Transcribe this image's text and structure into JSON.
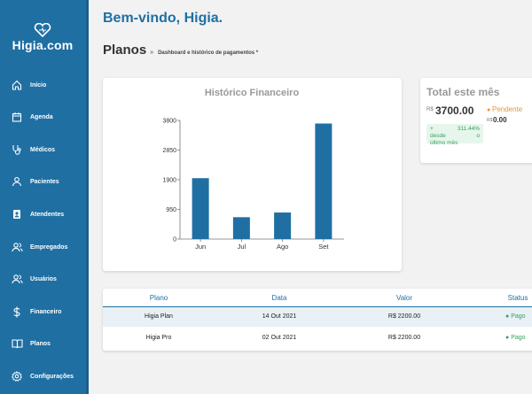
{
  "app": {
    "name": "Higia.com"
  },
  "sidebar": {
    "items": [
      {
        "label": "Início",
        "icon": "home-icon"
      },
      {
        "label": "Agenda",
        "icon": "calendar-icon"
      },
      {
        "label": "Médicos",
        "icon": "stethoscope-icon"
      },
      {
        "label": "Pacientes",
        "icon": "user-icon"
      },
      {
        "label": "Atendentes",
        "icon": "id-badge-icon"
      },
      {
        "label": "Empregados",
        "icon": "users-icon"
      },
      {
        "label": "Usuários",
        "icon": "users-icon"
      },
      {
        "label": "Financeiro",
        "icon": "dollar-icon"
      },
      {
        "label": "Planos",
        "icon": "book-icon"
      },
      {
        "label": "Configurações",
        "icon": "gear-icon"
      }
    ]
  },
  "header": {
    "welcome": "Bem-vindo, Higia.",
    "title": "Planos",
    "separator": "»",
    "subtitle": "Dashboard e histórico de pagamentos *"
  },
  "chart_data": {
    "type": "bar",
    "title": "Histórico Financeiro",
    "categories": [
      "Jun",
      "Jul",
      "Ago",
      "Set"
    ],
    "values": [
      1950,
      700,
      850,
      3700
    ],
    "yticks": [
      0,
      950,
      1900,
      2850,
      3800
    ],
    "ylim": [
      0,
      3800
    ],
    "xlabel": "",
    "ylabel": "",
    "grid": false,
    "bar_color": "#1f6fa3"
  },
  "total": {
    "title": "Total este mês",
    "currency": "R$",
    "value": "3700.00",
    "pending_label": "Pendente",
    "pending_currency": "R$",
    "pending_value": "0.00",
    "growth_plus": "+",
    "growth_percent": "311.44%",
    "growth_text1": "desde",
    "growth_text2": "o",
    "growth_text3": "último mês"
  },
  "table": {
    "headers": [
      "Plano",
      "Data",
      "Valor",
      "Status"
    ],
    "rows": [
      {
        "plano": "Higia Plan",
        "data": "14 Out 2021",
        "valor": "R$ 2200.00",
        "status": "Pago"
      },
      {
        "plano": "Higia Pro",
        "data": "02 Out 2021",
        "valor": "R$ 2200.00",
        "status": "Pago"
      }
    ]
  },
  "colors": {
    "primary": "#1f6fa3",
    "success": "#3aa05c",
    "warning": "#f0932b"
  }
}
